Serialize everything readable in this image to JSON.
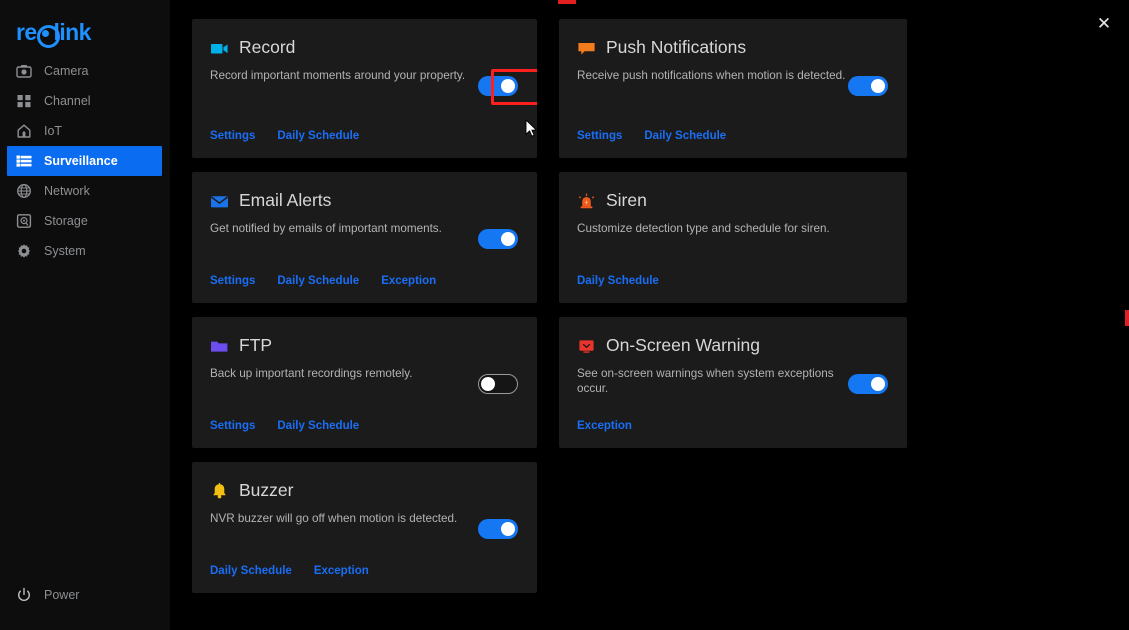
{
  "brand": {
    "name_before": "re",
    "name_after": "link"
  },
  "sidebar": {
    "items": [
      {
        "label": "Camera",
        "icon": "camera-icon",
        "active": false
      },
      {
        "label": "Channel",
        "icon": "channel-grid-icon",
        "active": false
      },
      {
        "label": "IoT",
        "icon": "iot-home-icon",
        "active": false
      },
      {
        "label": "Surveillance",
        "icon": "list-icon",
        "active": true
      },
      {
        "label": "Network",
        "icon": "globe-icon",
        "active": false
      },
      {
        "label": "Storage",
        "icon": "storage-disk-icon",
        "active": false
      },
      {
        "label": "System",
        "icon": "gear-icon",
        "active": false
      }
    ],
    "power": {
      "label": "Power",
      "icon": "power-icon"
    }
  },
  "header": {
    "close_icon": "close-icon",
    "close_label": "✕"
  },
  "colors": {
    "accent_blue": "#1677f2",
    "link_blue": "#1a6ef5",
    "nav_active": "#0a6cf0",
    "highlight_red": "#ff1f1f",
    "card_bg": "#1b1b1b",
    "page_bg": "#000000"
  },
  "cards": {
    "record": {
      "title": "Record",
      "desc": "Record important moments around your property.",
      "icon": "video-camera-icon",
      "icon_color": "#00b0e8",
      "toggle": {
        "state": "on",
        "label": "Record toggle"
      },
      "links": [
        "Settings",
        "Daily Schedule"
      ],
      "highlighted": true
    },
    "push_notifications": {
      "title": "Push Notifications",
      "desc": "Receive push notifications when motion is detected.",
      "icon": "speech-bubble-icon",
      "icon_color": "#f07c1e",
      "toggle": {
        "state": "on",
        "label": "Push Notifications toggle"
      },
      "links": [
        "Settings",
        "Daily Schedule"
      ],
      "highlighted": false
    },
    "email_alerts": {
      "title": "Email Alerts",
      "desc": "Get notified by emails of important moments.",
      "icon": "envelope-icon",
      "icon_color": "#1a73e8",
      "toggle": {
        "state": "on",
        "label": "Email Alerts toggle"
      },
      "links": [
        "Settings",
        "Daily Schedule",
        "Exception"
      ],
      "highlighted": false
    },
    "siren": {
      "title": "Siren",
      "desc": "Customize detection type and schedule for siren.",
      "icon": "siren-icon",
      "icon_color": "#f05a1e",
      "toggle": null,
      "links": [
        "Daily Schedule"
      ],
      "highlighted": false
    },
    "ftp": {
      "title": "FTP",
      "desc": "Back up important recordings remotely.",
      "icon": "folder-icon",
      "icon_color": "#6b4df0",
      "toggle": {
        "state": "off",
        "label": "FTP toggle"
      },
      "links": [
        "Settings",
        "Daily Schedule"
      ],
      "highlighted": false
    },
    "on_screen_warning": {
      "title": "On-Screen Warning",
      "desc": "See on-screen warnings when system exceptions occur.",
      "icon": "monitor-warning-icon",
      "icon_color": "#e8342a",
      "toggle": {
        "state": "on",
        "label": "On-Screen Warning toggle"
      },
      "links": [
        "Exception"
      ],
      "highlighted": false
    },
    "buzzer": {
      "title": "Buzzer",
      "desc": "NVR buzzer will go off when motion is detected.",
      "icon": "bell-icon",
      "icon_color": "#f2c012",
      "toggle": {
        "state": "on",
        "label": "Buzzer toggle"
      },
      "links": [
        "Daily Schedule",
        "Exception"
      ],
      "highlighted": false
    }
  }
}
